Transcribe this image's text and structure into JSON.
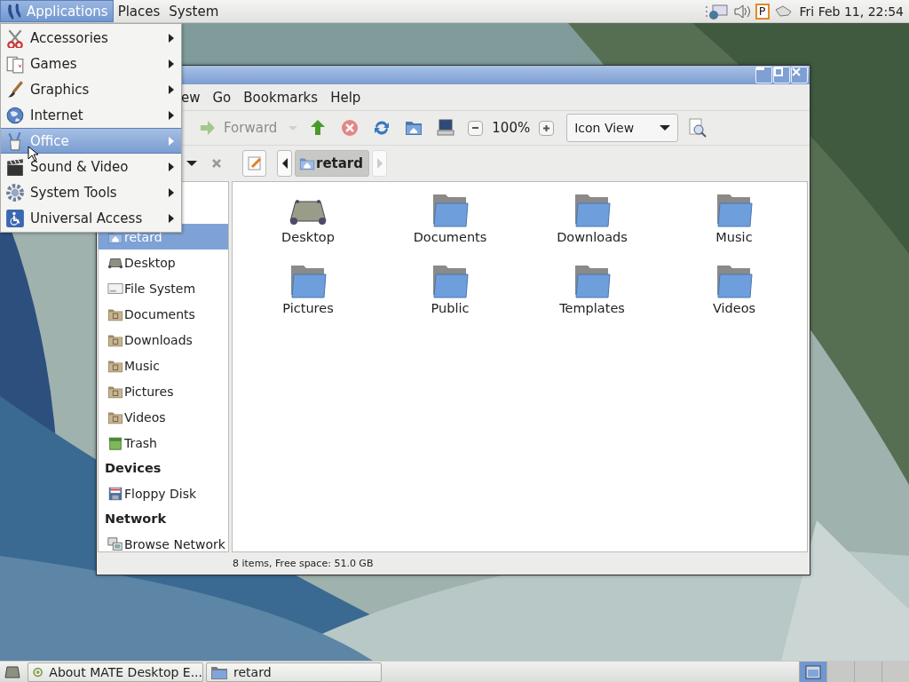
{
  "top_panel": {
    "menus": [
      {
        "label": "Applications",
        "selected": true
      },
      {
        "label": "Places",
        "selected": false
      },
      {
        "label": "System",
        "selected": false
      }
    ],
    "keyboard_indicator": "P",
    "clock": "Fri Feb 11, 22:54"
  },
  "applications_menu": {
    "items": [
      {
        "label": "Accessories",
        "kind": "accessories",
        "selected": false
      },
      {
        "label": "Games",
        "kind": "games",
        "selected": false
      },
      {
        "label": "Graphics",
        "kind": "graphics",
        "selected": false
      },
      {
        "label": "Internet",
        "kind": "internet",
        "selected": false
      },
      {
        "label": "Office",
        "kind": "office",
        "selected": true
      },
      {
        "label": "Sound & Video",
        "kind": "multimedia",
        "selected": false
      },
      {
        "label": "System Tools",
        "kind": "system",
        "selected": false
      },
      {
        "label": "Universal Access",
        "kind": "accessibility",
        "selected": false
      }
    ]
  },
  "window": {
    "menu_bar": [
      "ew",
      "Go",
      "Bookmarks",
      "Help"
    ],
    "toolbar": {
      "buttons": [
        {
          "kind": "forward",
          "label": "Forward",
          "disabled": true
        },
        {
          "kind": "dropdown",
          "disabled": true
        },
        {
          "kind": "up",
          "disabled": false
        },
        {
          "kind": "stop",
          "disabled": true
        },
        {
          "kind": "reload",
          "disabled": false
        },
        {
          "kind": "home",
          "disabled": false
        },
        {
          "kind": "computer",
          "disabled": false
        }
      ],
      "zoom_level": "100%",
      "view_mode": "Icon View"
    },
    "location_bar": {
      "crumbs": [
        {
          "label": "retard",
          "selected": true
        }
      ],
      "next_disabled": true
    },
    "sidebar": {
      "sections": [
        {
          "items": [
            {
              "label": "retard",
              "kind": "home",
              "selected": true
            },
            {
              "label": "Desktop",
              "kind": "desktop",
              "selected": false
            },
            {
              "label": "File System",
              "kind": "drive",
              "selected": false
            },
            {
              "label": "Documents",
              "kind": "folder",
              "selected": false
            },
            {
              "label": "Downloads",
              "kind": "folder",
              "selected": false
            },
            {
              "label": "Music",
              "kind": "folder",
              "selected": false
            },
            {
              "label": "Pictures",
              "kind": "folder",
              "selected": false
            },
            {
              "label": "Videos",
              "kind": "folder",
              "selected": false
            },
            {
              "label": "Trash",
              "kind": "trash",
              "selected": false
            }
          ]
        },
        {
          "heading": "Devices",
          "items": [
            {
              "label": "Floppy Disk",
              "kind": "floppy",
              "selected": false
            }
          ]
        },
        {
          "heading": "Network",
          "items": [
            {
              "label": "Browse Network",
              "kind": "network",
              "selected": false
            }
          ]
        }
      ]
    },
    "files": [
      {
        "name": "Desktop",
        "kind": "desktop"
      },
      {
        "name": "Documents",
        "kind": "folder"
      },
      {
        "name": "Downloads",
        "kind": "folder"
      },
      {
        "name": "Music",
        "kind": "folder"
      },
      {
        "name": "Pictures",
        "kind": "folder"
      },
      {
        "name": "Public",
        "kind": "folder"
      },
      {
        "name": "Templates",
        "kind": "folder"
      },
      {
        "name": "Videos",
        "kind": "folder"
      }
    ],
    "status_bar": "8 items, Free space: 51.0 GB"
  },
  "bottom_panel": {
    "tasks": [
      {
        "label": "About MATE Desktop E...",
        "kind": "about",
        "selected": false
      },
      {
        "label": "retard",
        "kind": "folder",
        "selected": false
      }
    ],
    "workspaces": [
      {
        "selected": true
      },
      {
        "selected": false
      },
      {
        "selected": false
      },
      {
        "selected": false
      }
    ]
  }
}
